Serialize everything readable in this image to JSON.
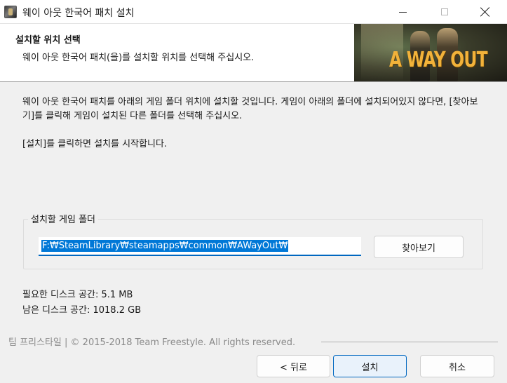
{
  "window": {
    "title": "웨이 아웃 한국어 패치 설치"
  },
  "header": {
    "title": "설치할 위치 선택",
    "subtitle": "웨이 아웃 한국어 패치(을)를 설치할 위치를 선택해 주십시오.",
    "banner_logo": "A WAY OUT"
  },
  "main": {
    "description": "웨이 아웃 한국어 패치를 아래의 게임 폴더 위치에 설치할 것입니다. 게임이 아래의 폴더에 설치되어있지 않다면, [찾아보기]를 클릭해 게임이 설치된 다른 폴더를 선택해 주십시오.",
    "hint": "[설치]를 클릭하면 설치를 시작합니다.",
    "folder_group_label": "설치할 게임 폴더",
    "folder_path": "F:₩SteamLibrary₩steamapps₩common₩AWayOut₩",
    "browse_label": "찾아보기",
    "space_required": "필요한 디스크 공간: 5.1 MB",
    "space_available": "남은 디스크 공간: 1018.2 GB"
  },
  "footer": {
    "branding": "팀 프리스타일 | © 2015-2018 Team Freestyle. All rights reserved.",
    "back_label": "< 뒤로",
    "install_label": "설치",
    "cancel_label": "취소"
  },
  "colors": {
    "accent": "#0067c0",
    "selection": "#0078d7",
    "logo": "#f2b23a"
  }
}
